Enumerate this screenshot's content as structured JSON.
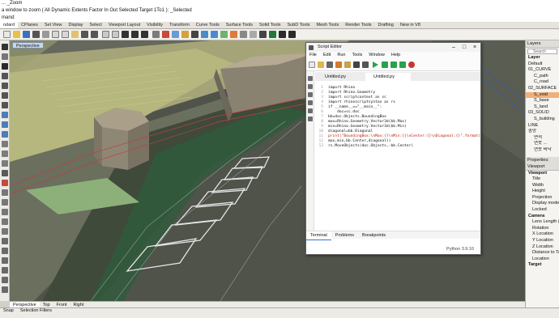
{
  "command_lines": {
    "line1": "... _Zoom",
    "line2": "a window to zoom ( All  Dynamic  Extents  Factor  In  Out  Selected  Target  1To1 ): _Selected",
    "line3": "mand:"
  },
  "ribbon_tabs": [
    "ndard",
    "CPlanes",
    "Set View",
    "Display",
    "Select",
    "Viewport Layout",
    "Visibility",
    "Transform",
    "Curve Tools",
    "Surface Tools",
    "Solid Tools",
    "SubD Tools",
    "Mesh Tools",
    "Render Tools",
    "Drafting",
    "New in V8"
  ],
  "viewport": {
    "active_tab": "Perspective",
    "bottom_tabs": [
      "Perspective",
      "Top",
      "Front",
      "Right"
    ]
  },
  "statusbar": {
    "items": [
      "Snap",
      "Selection Filters"
    ]
  },
  "script_editor": {
    "title": "Script Editor",
    "menu": [
      "File",
      "Edit",
      "Run",
      "Tools",
      "Window",
      "Help"
    ],
    "doc_tabs": [
      "Untitled.py",
      "Untitled.py"
    ],
    "code": [
      {
        "n": "1",
        "text": "import Rhino"
      },
      {
        "n": "2",
        "text": "import Rhino.Geometry"
      },
      {
        "n": "3",
        "text": "import scriptcontext as sc"
      },
      {
        "n": "4",
        "text": "import rhinoscriptsyntax as rs"
      },
      {
        "n": "5",
        "text": "if __name__==\"__main__\":"
      },
      {
        "n": "6",
        "text": "    doc=sc.doc"
      },
      {
        "n": "7",
        "text": "bb=doc.Objects.BoundingBox"
      },
      {
        "n": "8",
        "text": "max=Rhino.Geometry.Vector3d(bb.Max)"
      },
      {
        "n": "9",
        "text": "min=Rhino.Geometry.Vector3d(bb.Min)"
      },
      {
        "n": "10",
        "text": "diagonal=bb.Diagonal"
      },
      {
        "n": "11",
        "text": "print(\"BoundingBox:\\nMax:{}\\nMin:{}\\nCenter:{}\\nDiagonal:{}\".format("
      },
      {
        "n": "12",
        "text": "max,min,bb.Center,diagonal))"
      },
      {
        "n": "13",
        "text": "rs.MoveObjects(doc.Objects,-bb.Center)"
      }
    ],
    "bottom_tabs": [
      "Terminal",
      "Problems",
      "Breakpoints"
    ],
    "status": "Python 3.9.10"
  },
  "layers_panel": {
    "title": "Layers",
    "search_placeholder": "Search",
    "header": "Layer",
    "rows": [
      "Default",
      "01_CURVE",
      "C_path",
      "C_road",
      "02_SURFACE",
      "S_void",
      "S_base",
      "S_land",
      "03_SOLID",
      "S_building",
      "LINE",
      "중앙",
      "면적",
      "연못 ...",
      "연못 바닥"
    ],
    "selected_index": 5
  },
  "properties_panel": {
    "title": "Properties: Viewport",
    "section_viewport": "Viewport",
    "viewport_rows": [
      "Title",
      "Width",
      "Height",
      "Projection",
      "Display mode",
      "Locked"
    ],
    "section_camera": "Camera",
    "camera_rows": [
      "Lens Length (mm)",
      "Rotation",
      "X Location",
      "Y Location",
      "Z Location",
      "Distance to Target",
      "Location"
    ],
    "section_target": "Target"
  },
  "colors": {
    "selected_layer": "#f0b07c",
    "viewport_bg": "#4b4e45",
    "run_green": "#2aa14a"
  }
}
